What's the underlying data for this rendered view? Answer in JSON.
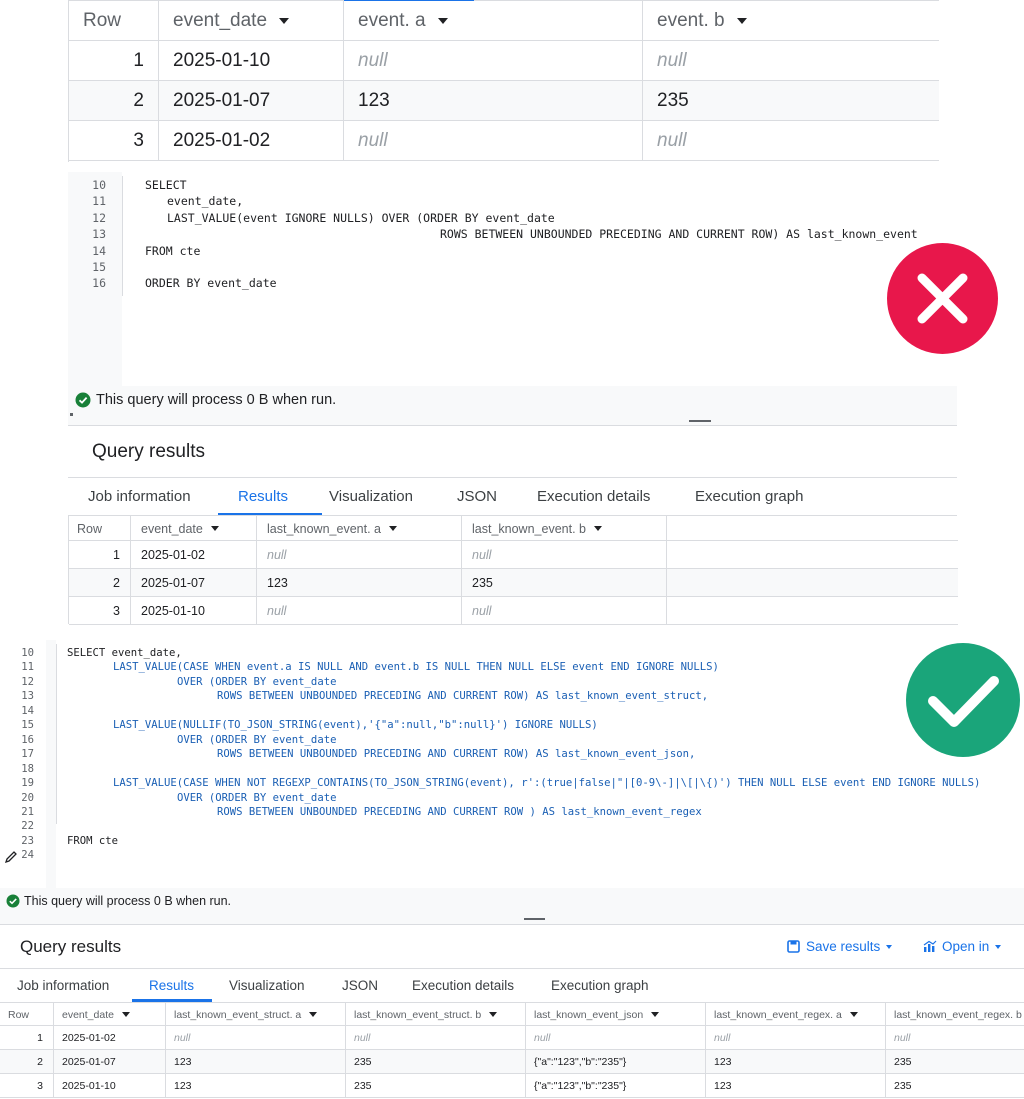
{
  "top_table": {
    "headers": [
      "Row",
      "event_date",
      "event. a",
      "event. b"
    ],
    "rows": [
      [
        "1",
        "2025-01-10",
        "null",
        "null"
      ],
      [
        "2",
        "2025-01-07",
        "123",
        "235"
      ],
      [
        "3",
        "2025-01-02",
        "null",
        "null"
      ]
    ]
  },
  "editor1": {
    "lines": [
      {
        "n": "10",
        "text": "SELECT"
      },
      {
        "n": "11",
        "text": "event_date,"
      },
      {
        "n": "12",
        "text": "LAST_VALUE(event IGNORE NULLS) OVER (ORDER BY event_date"
      },
      {
        "n": "13",
        "text": "ROWS BETWEEN UNBOUNDED PRECEDING AND CURRENT ROW) AS last_known_event"
      },
      {
        "n": "14",
        "text": "FROM cte"
      },
      {
        "n": "15",
        "text": ""
      },
      {
        "n": "16",
        "text": "ORDER BY event_date"
      }
    ],
    "status": "This query will process 0 B when run."
  },
  "results1": {
    "title": "Query results",
    "tabs": [
      "Job information",
      "Results",
      "Visualization",
      "JSON",
      "Execution details",
      "Execution graph"
    ],
    "headers": [
      "Row",
      "event_date",
      "last_known_event. a",
      "last_known_event. b"
    ],
    "rows": [
      [
        "1",
        "2025-01-02",
        "null",
        "null"
      ],
      [
        "2",
        "2025-01-07",
        "123",
        "235"
      ],
      [
        "3",
        "2025-01-10",
        "null",
        "null"
      ]
    ]
  },
  "editor2": {
    "lines": [
      {
        "n": "10",
        "text": "SELECT event_date,"
      },
      {
        "n": "11",
        "text": "LAST_VALUE(CASE WHEN event.a IS NULL AND event.b IS NULL THEN NULL ELSE event END IGNORE NULLS)"
      },
      {
        "n": "12",
        "text": "OVER (ORDER BY event_date"
      },
      {
        "n": "13",
        "text": "ROWS BETWEEN UNBOUNDED PRECEDING AND CURRENT ROW) AS last_known_event_struct,"
      },
      {
        "n": "14",
        "text": ""
      },
      {
        "n": "15",
        "text": "LAST_VALUE(NULLIF(TO_JSON_STRING(event),'{\"a\":null,\"b\":null}') IGNORE NULLS)"
      },
      {
        "n": "16",
        "text": "OVER (ORDER BY event_date"
      },
      {
        "n": "17",
        "text": "ROWS BETWEEN UNBOUNDED PRECEDING AND CURRENT ROW) AS last_known_event_json,"
      },
      {
        "n": "18",
        "text": ""
      },
      {
        "n": "19",
        "text": "LAST_VALUE(CASE WHEN NOT REGEXP_CONTAINS(TO_JSON_STRING(event), r':(true|false|\"|[0-9\\-]|\\[|\\{)') THEN NULL ELSE event END IGNORE NULLS)"
      },
      {
        "n": "20",
        "text": "OVER (ORDER BY event_date"
      },
      {
        "n": "21",
        "text": "ROWS BETWEEN UNBOUNDED PRECEDING AND CURRENT ROW ) AS last_known_event_regex"
      },
      {
        "n": "22",
        "text": ""
      },
      {
        "n": "23",
        "text": "FROM cte"
      },
      {
        "n": "24",
        "text": ""
      }
    ],
    "status": "This query will process 0 B when run."
  },
  "results2": {
    "title": "Query results",
    "save_results": "Save results",
    "open_in": "Open in",
    "tabs": [
      "Job information",
      "Results",
      "Visualization",
      "JSON",
      "Execution details",
      "Execution graph"
    ],
    "headers": [
      "Row",
      "event_date",
      "last_known_event_struct. a",
      "last_known_event_struct. b",
      "last_known_event_json",
      "last_known_event_regex. a",
      "last_known_event_regex. b"
    ],
    "rows": [
      [
        "1",
        "2025-01-02",
        "null",
        "null",
        "null",
        "null",
        "null"
      ],
      [
        "2",
        "2025-01-07",
        "123",
        "235",
        "{\"a\":\"123\",\"b\":\"235\"}",
        "123",
        "235"
      ],
      [
        "3",
        "2025-01-10",
        "123",
        "235",
        "{\"a\":\"123\",\"b\":\"235\"}",
        "123",
        "235"
      ]
    ]
  },
  "colors": {
    "error": "#e8174b",
    "success": "#1aa57a",
    "accent": "#1a73e8",
    "keyword": "#1a5fb4"
  }
}
